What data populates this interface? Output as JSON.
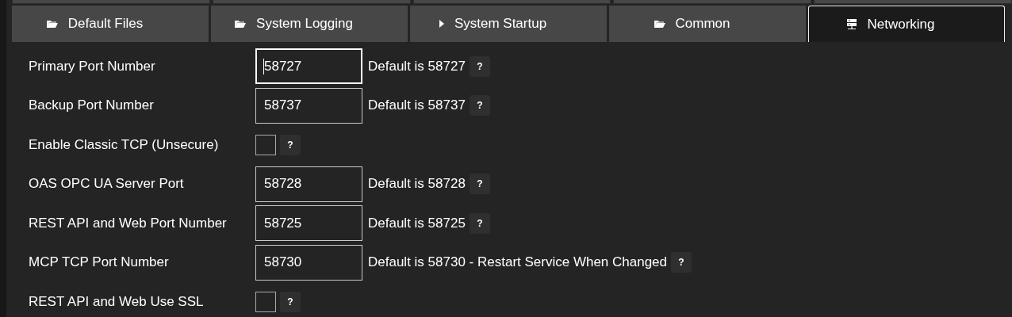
{
  "tabs": [
    {
      "label": "Default Files",
      "kind": "folder",
      "selected": false
    },
    {
      "label": "System Logging",
      "kind": "folder",
      "selected": false
    },
    {
      "label": "System Startup",
      "kind": "play",
      "selected": false
    },
    {
      "label": "Common",
      "kind": "folder",
      "selected": false
    },
    {
      "label": "Networking",
      "kind": "server",
      "selected": true
    }
  ],
  "rows": [
    {
      "kind": "port",
      "label": "Primary Port Number",
      "value": "58727",
      "focused": true,
      "note": "Default is 58727",
      "help": "?"
    },
    {
      "kind": "port",
      "label": "Backup Port Number",
      "value": "58737",
      "focused": false,
      "note": "Default is 58737",
      "help": "?"
    },
    {
      "kind": "checkbox",
      "label": "Enable Classic TCP (Unsecure)",
      "checked": false,
      "help": "?"
    },
    {
      "kind": "port",
      "label": "OAS OPC UA Server Port",
      "value": "58728",
      "focused": false,
      "note": "Default is 58728",
      "help": "?"
    },
    {
      "kind": "port",
      "label": "REST API and Web Port Number",
      "value": "58725",
      "focused": false,
      "note": "Default is 58725",
      "help": "?"
    },
    {
      "kind": "port",
      "label": "MCP TCP Port Number",
      "value": "58730",
      "focused": false,
      "note": "Default is 58730 - Restart Service When Changed",
      "help": "?"
    },
    {
      "kind": "checkbox",
      "label": "REST API and Web Use SSL",
      "checked": false,
      "help": "?"
    }
  ]
}
